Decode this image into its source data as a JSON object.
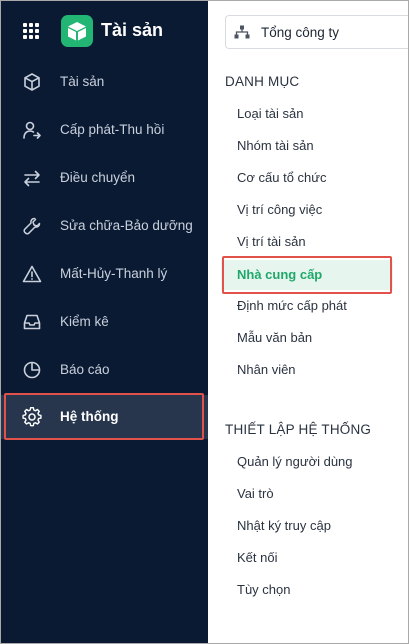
{
  "app": {
    "title": "Tài sản"
  },
  "sidebar": {
    "items": [
      {
        "label": "Tài sản",
        "icon": "cube-icon"
      },
      {
        "label": "Cấp phát-Thu hồi",
        "icon": "user-arrow-icon"
      },
      {
        "label": "Điều chuyển",
        "icon": "transfer-arrows-icon"
      },
      {
        "label": "Sửa chữa-Bảo dưỡng",
        "icon": "wrench-icon"
      },
      {
        "label": "Mất-Hủy-Thanh lý",
        "icon": "warning-icon"
      },
      {
        "label": "Kiểm kê",
        "icon": "inbox-icon"
      },
      {
        "label": "Báo cáo",
        "icon": "pie-chart-icon"
      },
      {
        "label": "Hệ thống",
        "icon": "gear-icon",
        "active": true
      }
    ]
  },
  "panel": {
    "company_selector": {
      "label": "Tổng công ty",
      "icon": "org-chart-icon"
    },
    "section_catalog": {
      "title": "DANH MỤC",
      "items": [
        "Loại tài sản",
        "Nhóm tài sản",
        "Cơ cấu tổ chức",
        "Vị trí công việc",
        "Vị trí tài sản",
        "Nhà cung cấp",
        "Định mức cấp phát",
        "Mẫu văn bản",
        "Nhân viên"
      ],
      "active_item": "Nhà cung cấp"
    },
    "section_settings": {
      "title": "THIẾT LẬP HỆ THỐNG",
      "items": [
        "Quản lý người dùng",
        "Vai trò",
        "Nhật ký truy cập",
        "Kết nối",
        "Tùy chọn"
      ]
    }
  },
  "colors": {
    "sidebar_bg": "#0b1a33",
    "sidebar_active_bg": "#27364d",
    "brand_green": "#22b573",
    "active_menu_bg": "#e6f6ef",
    "active_menu_text": "#20a86a",
    "highlight_border": "#e0524a"
  }
}
